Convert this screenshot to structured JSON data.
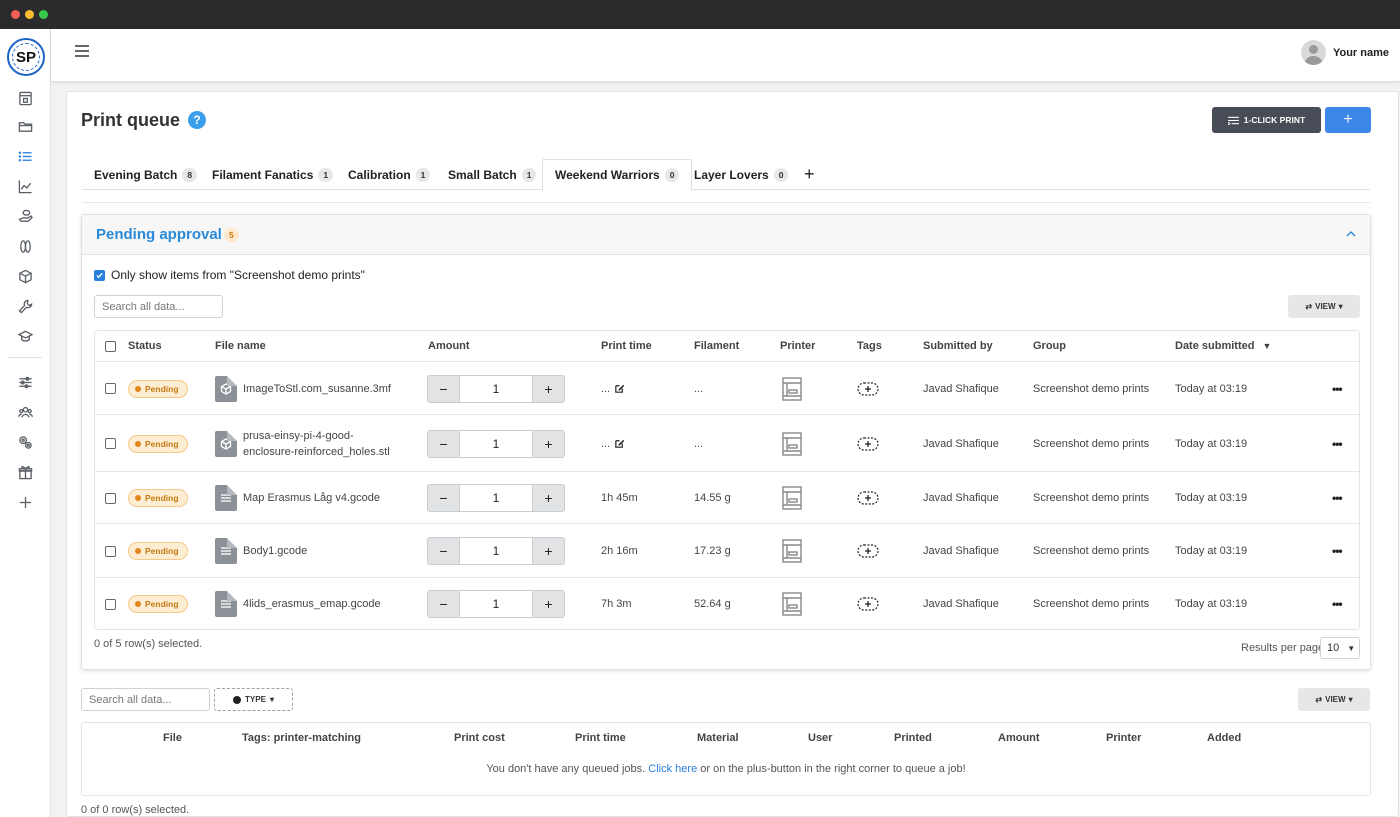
{
  "sidebar": {
    "logo_text": "SP",
    "items": [
      {
        "icon": "printer-dashboard-icon"
      },
      {
        "icon": "folder-icon"
      },
      {
        "icon": "list-icon",
        "active": true
      },
      {
        "icon": "chart-line-icon"
      },
      {
        "icon": "hand-spool-icon"
      },
      {
        "icon": "spool-icon"
      },
      {
        "icon": "cube-icon"
      },
      {
        "icon": "wrench-icon"
      },
      {
        "icon": "graduation-cap-icon"
      },
      {
        "icon": "sliders-icon"
      },
      {
        "icon": "users-icon"
      },
      {
        "icon": "gears-icon"
      },
      {
        "icon": "gift-icon"
      },
      {
        "icon": "plus-icon"
      }
    ]
  },
  "header": {
    "user_name": "Your name"
  },
  "page": {
    "title": "Print queue",
    "help_label": "?",
    "one_click_label": "1-CLICK PRINT",
    "add_label": "+"
  },
  "tabs": [
    {
      "label": "Evening Batch",
      "count": "8"
    },
    {
      "label": "Filament Fanatics",
      "count": "1"
    },
    {
      "label": "Calibration",
      "count": "1"
    },
    {
      "label": "Small Batch",
      "count": "1"
    },
    {
      "label": "Weekend Warriors",
      "count": "0",
      "active": true
    },
    {
      "label": "Layer Lovers",
      "count": "0"
    }
  ],
  "tab_add_label": "+",
  "pending": {
    "title": "Pending approval",
    "count": "5",
    "filter_label": "Only show items from \"Screenshot demo prints\"",
    "filter_checked": true,
    "search_placeholder": "Search all data...",
    "view_label": "VIEW",
    "columns": [
      "Status",
      "File name",
      "Amount",
      "Print time",
      "Filament",
      "Printer",
      "Tags",
      "Submitted by",
      "Group",
      "Date submitted"
    ],
    "rows": [
      {
        "status": "Pending",
        "file": [
          "ImageToStl.com_susanne.3mf"
        ],
        "file_type": "3d",
        "amount": "1",
        "print_time": "...",
        "print_time_editable": true,
        "filament": "...",
        "submitted_by": "Javad Shafique",
        "group": "Screenshot demo prints",
        "date": "Today at 03:19"
      },
      {
        "status": "Pending",
        "file": [
          "prusa-einsy-pi-4-good-",
          "enclosure-reinforced_holes.stl"
        ],
        "file_type": "3d",
        "amount": "1",
        "print_time": "...",
        "print_time_editable": true,
        "filament": "...",
        "submitted_by": "Javad Shafique",
        "group": "Screenshot demo prints",
        "date": "Today at 03:19"
      },
      {
        "status": "Pending",
        "file": [
          "Map Erasmus Låg v4.gcode"
        ],
        "file_type": "gcode",
        "amount": "1",
        "print_time": "1h 45m",
        "print_time_editable": false,
        "filament": "14.55 g",
        "submitted_by": "Javad Shafique",
        "group": "Screenshot demo prints",
        "date": "Today at 03:19"
      },
      {
        "status": "Pending",
        "file": [
          "Body1.gcode"
        ],
        "file_type": "gcode",
        "amount": "1",
        "print_time": "2h 16m",
        "print_time_editable": false,
        "filament": "17.23 g",
        "submitted_by": "Javad Shafique",
        "group": "Screenshot demo prints",
        "date": "Today at 03:19"
      },
      {
        "status": "Pending",
        "file": [
          "4lids_erasmus_emap.gcode"
        ],
        "file_type": "gcode",
        "amount": "1",
        "print_time": "7h 3m",
        "print_time_editable": false,
        "filament": "52.64 g",
        "submitted_by": "Javad Shafique",
        "group": "Screenshot demo prints",
        "date": "Today at 03:19"
      }
    ],
    "selected_text": "0 of 5 row(s) selected.",
    "results_per_page_label": "Results per page",
    "results_per_page_value": "10"
  },
  "queue": {
    "search_placeholder": "Search all data...",
    "type_label": "TYPE",
    "view_label": "VIEW",
    "columns": [
      "File",
      "Tags: printer-matching",
      "Print cost",
      "Print time",
      "Material",
      "User",
      "Printed",
      "Amount",
      "Printer",
      "Added"
    ],
    "empty_before": "You don't have any queued jobs.",
    "empty_link": "Click here",
    "empty_after": "or on the plus-button in the right corner to queue a job!",
    "selected_text": "0 of 0 row(s) selected."
  },
  "colors": {
    "accent": "#2a8ad8",
    "primary_button": "#3c87e8",
    "dark_button": "#474c56",
    "pending": "#e3861c"
  }
}
